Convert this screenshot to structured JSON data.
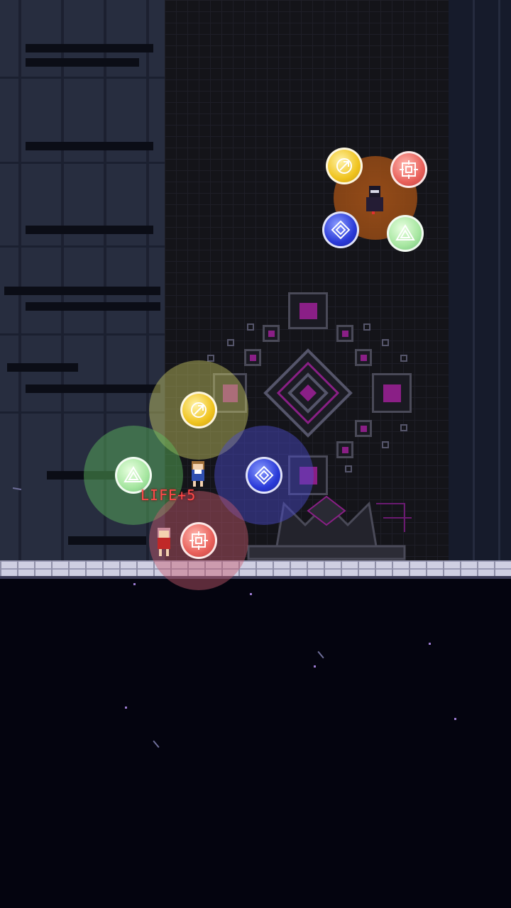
{
  "scene": {
    "hud_popup": "LIFE+5",
    "colors": {
      "aura_yellow": "#d9d96a",
      "aura_green": "#5fbf5f",
      "aura_blue": "#4b4bd0",
      "aura_red": "#c85a6e",
      "aura_brown": "#9b4e18",
      "popup_text": "#ff4a4a",
      "machine_accent": "#8a1f86"
    },
    "orbs_boss": [
      "yellow-orb",
      "red-orb",
      "blue-orb",
      "green-orb"
    ],
    "orbs_player": [
      "yellow-orb",
      "green-orb",
      "blue-orb",
      "red-orb"
    ],
    "characters": [
      "boss-dark-figure",
      "player-girl-blue",
      "companion-girl-red"
    ]
  }
}
